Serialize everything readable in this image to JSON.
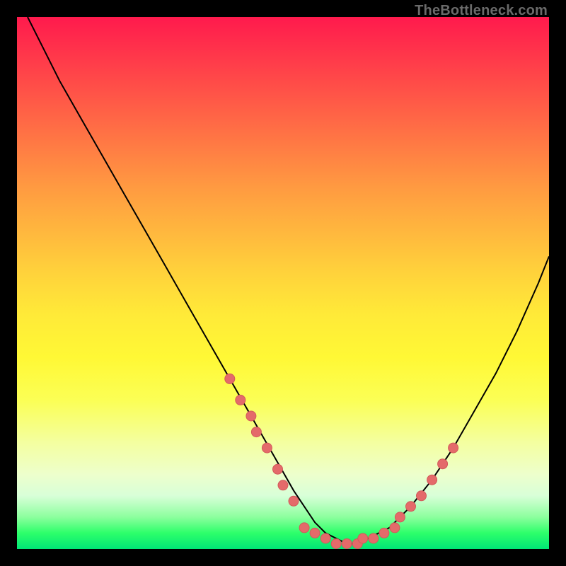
{
  "watermark": "TheBottleneck.com",
  "chart_data": {
    "type": "line",
    "title": "",
    "xlabel": "",
    "ylabel": "",
    "xlim": [
      0,
      100
    ],
    "ylim": [
      0,
      100
    ],
    "grid": false,
    "legend": false,
    "background_gradient": {
      "top": "#ff1a4d",
      "mid": "#ffea38",
      "bottom": "#00e676"
    },
    "series": [
      {
        "name": "curve",
        "x": [
          2,
          5,
          8,
          12,
          16,
          20,
          24,
          28,
          32,
          36,
          40,
          44,
          48,
          52,
          56,
          58,
          60,
          62,
          64,
          66,
          70,
          74,
          78,
          82,
          86,
          90,
          94,
          98,
          100
        ],
        "y": [
          100,
          94,
          88,
          81,
          74,
          67,
          60,
          53,
          46,
          39,
          32,
          25,
          18,
          11,
          5,
          3,
          2,
          1,
          1,
          2,
          4,
          8,
          13,
          19,
          26,
          33,
          41,
          50,
          55
        ]
      }
    ],
    "markers": [
      {
        "name": "left-cluster",
        "x": [
          40,
          42,
          44,
          45,
          47,
          49,
          50,
          52
        ],
        "y": [
          32,
          28,
          25,
          22,
          19,
          15,
          12,
          9
        ]
      },
      {
        "name": "valley-cluster",
        "x": [
          54,
          56,
          58,
          60,
          62,
          64,
          65,
          67,
          69,
          71
        ],
        "y": [
          4,
          3,
          2,
          1,
          1,
          1,
          2,
          2,
          3,
          4
        ]
      },
      {
        "name": "right-cluster",
        "x": [
          72,
          74,
          76,
          78,
          80,
          82
        ],
        "y": [
          6,
          8,
          10,
          13,
          16,
          19
        ]
      }
    ],
    "marker_color": "#e46a6a"
  }
}
